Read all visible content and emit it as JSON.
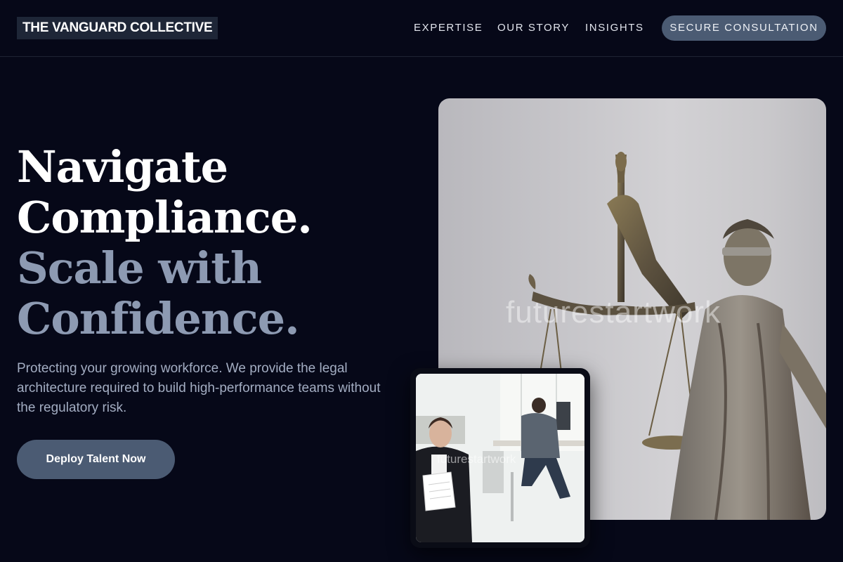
{
  "header": {
    "logo": "THE VANGUARD COLLECTIVE",
    "nav": [
      "EXPERTISE",
      "OUR STORY",
      "INSIGHTS"
    ],
    "cta": "SECURE CONSULTATION"
  },
  "hero": {
    "headline": [
      "Navigate",
      "Compliance.",
      "Scale with",
      "Confidence."
    ],
    "subtext": "Protecting your growing workforce. We provide the legal architecture required to build high-performance teams without the regulatory risk.",
    "cta": "Deploy Talent Now"
  },
  "images": {
    "main": {
      "subject": "bronze statue of Lady Justice holding scales",
      "watermark": "futurestartwork"
    },
    "inset": {
      "subject": "woman reading document in office",
      "watermark": "futurestartwork"
    }
  },
  "colors": {
    "background": "#060818",
    "button": "#4b5b73",
    "headline_accent": "#8d9ab2",
    "body_text": "#a3adc2"
  }
}
